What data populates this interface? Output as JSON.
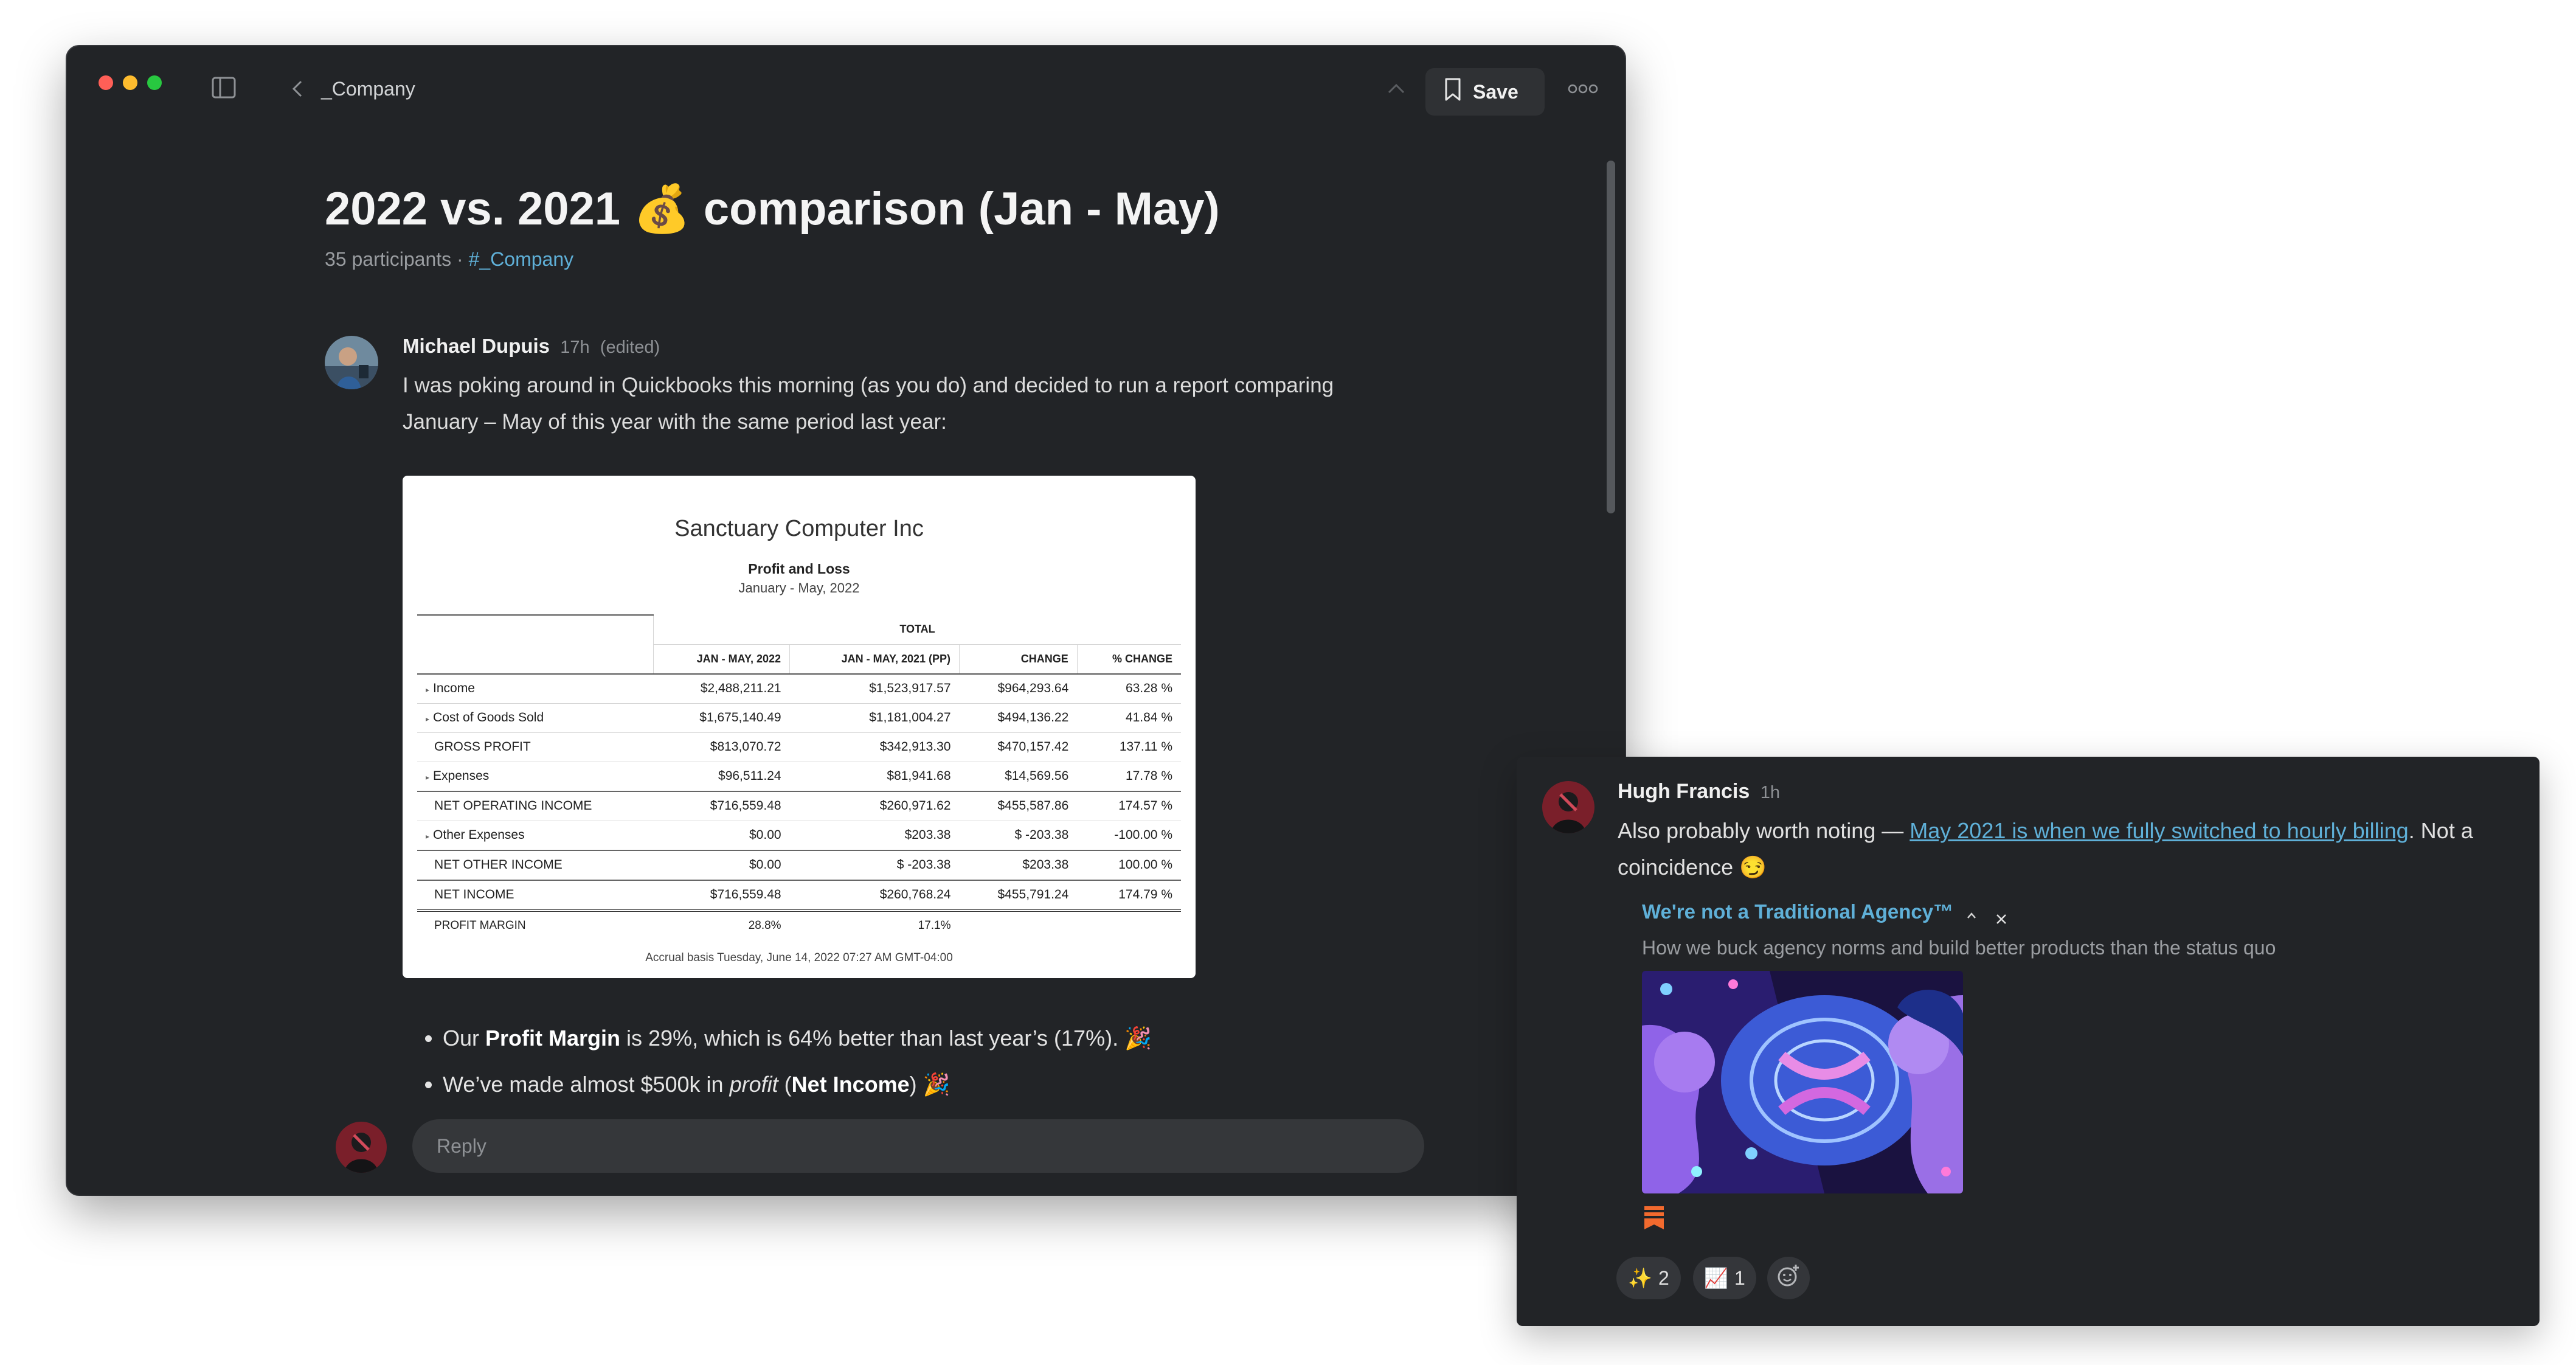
{
  "window": {
    "breadcrumb": "_Company",
    "save_label": "Save"
  },
  "post": {
    "title": "2022 vs. 2021 💰 comparison (Jan - May)",
    "participants": "35 participants",
    "separator": "·",
    "channel": "#_Company"
  },
  "message": {
    "author": "Michael Dupuis",
    "time": "17h",
    "edited": "(edited)",
    "text": "I was poking around in Quickbooks this morning (as you do) and decided to run a report comparing January – May of this year with the same period last year:"
  },
  "report": {
    "company": "Sanctuary Computer Inc",
    "title": "Profit and Loss",
    "period": "January - May, 2022",
    "total_header": "TOTAL",
    "columns": [
      "JAN - MAY, 2022",
      "JAN - MAY, 2021 (PP)",
      "CHANGE",
      "% CHANGE"
    ],
    "rows": [
      {
        "label": "Income",
        "arrow": "▸",
        "c1": "$2,488,211.21",
        "c2": "$1,523,917.57",
        "c3": "$964,293.64",
        "c4": "63.28 %"
      },
      {
        "label": "Cost of Goods Sold",
        "arrow": "▸",
        "c1": "$1,675,140.49",
        "c2": "$1,181,004.27",
        "c3": "$494,136.22",
        "c4": "41.84 %"
      },
      {
        "label": "GROSS PROFIT",
        "arrow": "",
        "c1": "$813,070.72",
        "c2": "$342,913.30",
        "c3": "$470,157.42",
        "c4": "137.11 %"
      },
      {
        "label": "Expenses",
        "arrow": "▸",
        "c1": "$96,511.24",
        "c2": "$81,941.68",
        "c3": "$14,569.56",
        "c4": "17.78 %"
      },
      {
        "label": "NET OPERATING INCOME",
        "arrow": "",
        "c1": "$716,559.48",
        "c2": "$260,971.62",
        "c3": "$455,587.86",
        "c4": "174.57 %"
      },
      {
        "label": "Other Expenses",
        "arrow": "▸",
        "c1": "$0.00",
        "c2": "$203.38",
        "c3": "$ -203.38",
        "c4": "-100.00 %"
      },
      {
        "label": "NET OTHER INCOME",
        "arrow": "",
        "c1": "$0.00",
        "c2": "$ -203.38",
        "c3": "$203.38",
        "c4": "100.00 %"
      },
      {
        "label": "NET INCOME",
        "arrow": "",
        "c1": "$716,559.48",
        "c2": "$260,768.24",
        "c3": "$455,791.24",
        "c4": "174.79 %"
      },
      {
        "label": "PROFIT MARGIN",
        "arrow": "",
        "c1": "28.8%",
        "c2": "17.1%",
        "c3": "",
        "c4": ""
      }
    ],
    "footer": "Accrual basis  Tuesday, June 14, 2022  07:27 AM GMT-04:00"
  },
  "bullets": {
    "b1_pre": "Our ",
    "b1_bold": "Profit Margin",
    "b1_post": " is 29%, which is 64% better than last year’s (17%). 🎉",
    "b2_pre": "We’ve made almost $500k in ",
    "b2_italic": "profit",
    "b2_mid": " (",
    "b2_bold": "Net Income",
    "b2_post": ") 🎉"
  },
  "reply": {
    "placeholder": "Reply"
  },
  "side": {
    "author": "Hugh Francis",
    "time": "1h",
    "text_pre": "Also probably worth noting — ",
    "link": "May 2021 is when we fully switched to hourly billing",
    "text_post": ". Not a coincidence 😏",
    "unfurl_title": "We're not a Traditional Agency™",
    "unfurl_desc": "How we buck agency norms and build better products than the status quo",
    "reactions": [
      {
        "emoji": "✨",
        "count": "2"
      },
      {
        "emoji": "📈",
        "count": "1"
      }
    ]
  },
  "colors": {
    "window_bg": "#222427",
    "link": "#5fb0d8",
    "traffic_red": "#ff5f57",
    "traffic_yellow": "#febc2e",
    "traffic_green": "#28c840"
  },
  "icons": [
    "sidebar-toggle-icon",
    "chevron-left-icon",
    "chevron-up-icon",
    "chevron-down-icon",
    "bookmark-icon",
    "more-icon",
    "collapse-icon",
    "close-icon",
    "bookmark-stack-icon",
    "add-reaction-icon"
  ]
}
